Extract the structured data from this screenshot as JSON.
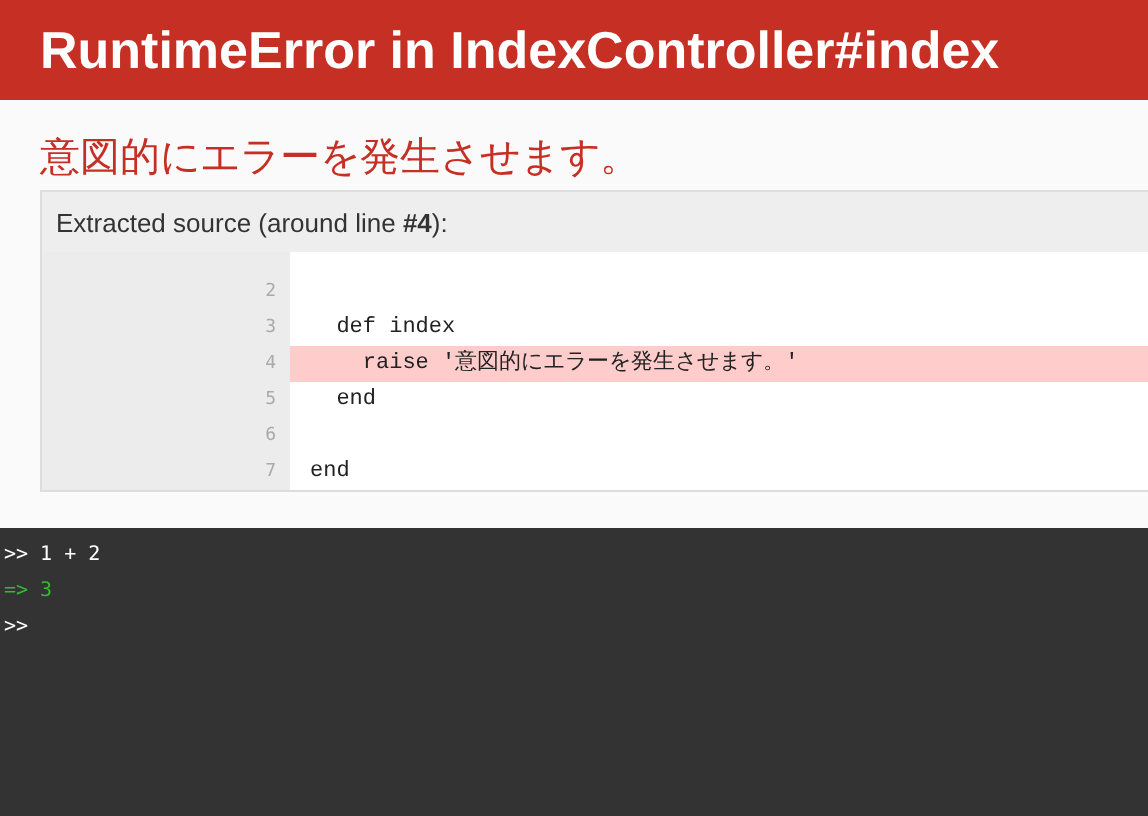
{
  "header": {
    "title": "RuntimeError in IndexController#index"
  },
  "message": "意図的にエラーを発生させます。",
  "source": {
    "heading": "Extracted source (around line **#4**):",
    "lines": [
      {
        "number": "2",
        "selected": false
      },
      {
        "number": "3",
        "code": "  def index",
        "selected": false
      },
      {
        "number": "4",
        "code": "    raise '意図的にエラーを発生させます。'",
        "selected": true
      },
      {
        "number": "5",
        "code": "  end",
        "selected": false
      },
      {
        "number": "6",
        "selected": false
      },
      {
        "number": "7",
        "code": "end",
        "selected": false
      }
    ]
  },
  "console": {
    "lines": [
      {
        "kind": "input",
        "text": ">> 1 + 2"
      },
      {
        "kind": "output",
        "text": "=> 3"
      },
      {
        "kind": "input",
        "text": ">>"
      }
    ]
  }
}
